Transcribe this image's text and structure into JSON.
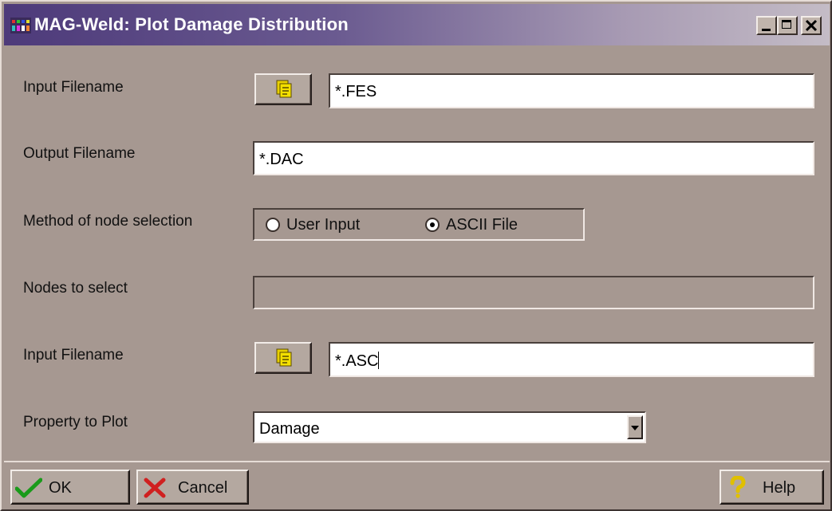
{
  "window": {
    "title": "MAG-Weld: Plot Damage Distribution"
  },
  "form": {
    "input_filename_label": "Input Filename",
    "input_filename_value": "*.FES",
    "output_filename_label": "Output Filename",
    "output_filename_value": "*.DAC",
    "method_label": "Method of node selection",
    "method_options": [
      "User Input",
      "ASCII File"
    ],
    "method_selected": "ASCII File",
    "nodes_label": "Nodes to select",
    "nodes_value": "",
    "input_filename2_label": "Input Filename",
    "input_filename2_value": "*.ASC",
    "property_label": "Property to Plot",
    "property_value": "Damage"
  },
  "buttons": {
    "ok": "OK",
    "cancel": "Cancel",
    "help": "Help"
  },
  "icons": [
    "app-icon",
    "minimize-icon",
    "maximize-icon",
    "close-icon",
    "folder-browse-icon",
    "checkmark-icon",
    "red-x-icon",
    "question-mark-icon"
  ]
}
